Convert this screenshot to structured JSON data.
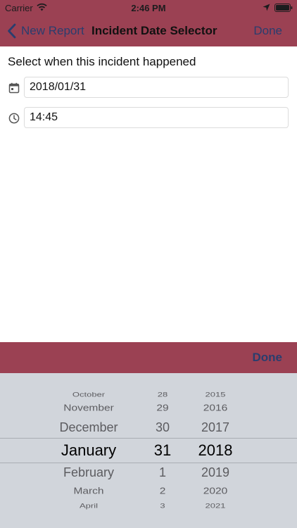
{
  "status_bar": {
    "carrier": "Carrier",
    "time": "2:46 PM"
  },
  "nav": {
    "back_label": "New Report",
    "title": "Incident Date Selector",
    "done_label": "Done"
  },
  "form": {
    "prompt": "Select when this incident happened",
    "date_value": "2018/01/31",
    "time_value": "14:45"
  },
  "toolbar": {
    "done_label": "Done"
  },
  "picker": {
    "months": [
      "October",
      "November",
      "December",
      "January",
      "February",
      "March",
      "April"
    ],
    "days": [
      "28",
      "29",
      "30",
      "31",
      "1",
      "2",
      "3"
    ],
    "years": [
      "2015",
      "2016",
      "2017",
      "2018",
      "2019",
      "2020",
      "2021"
    ],
    "selected_month": "January",
    "selected_day": "31",
    "selected_year": "2018"
  },
  "colors": {
    "bar": "#9b4153",
    "accent": "#2a3d6e",
    "picker_bg": "#d1d5db"
  },
  "icons": {
    "date": "calendar-icon",
    "time": "clock-icon",
    "back": "chevron-left-icon"
  }
}
